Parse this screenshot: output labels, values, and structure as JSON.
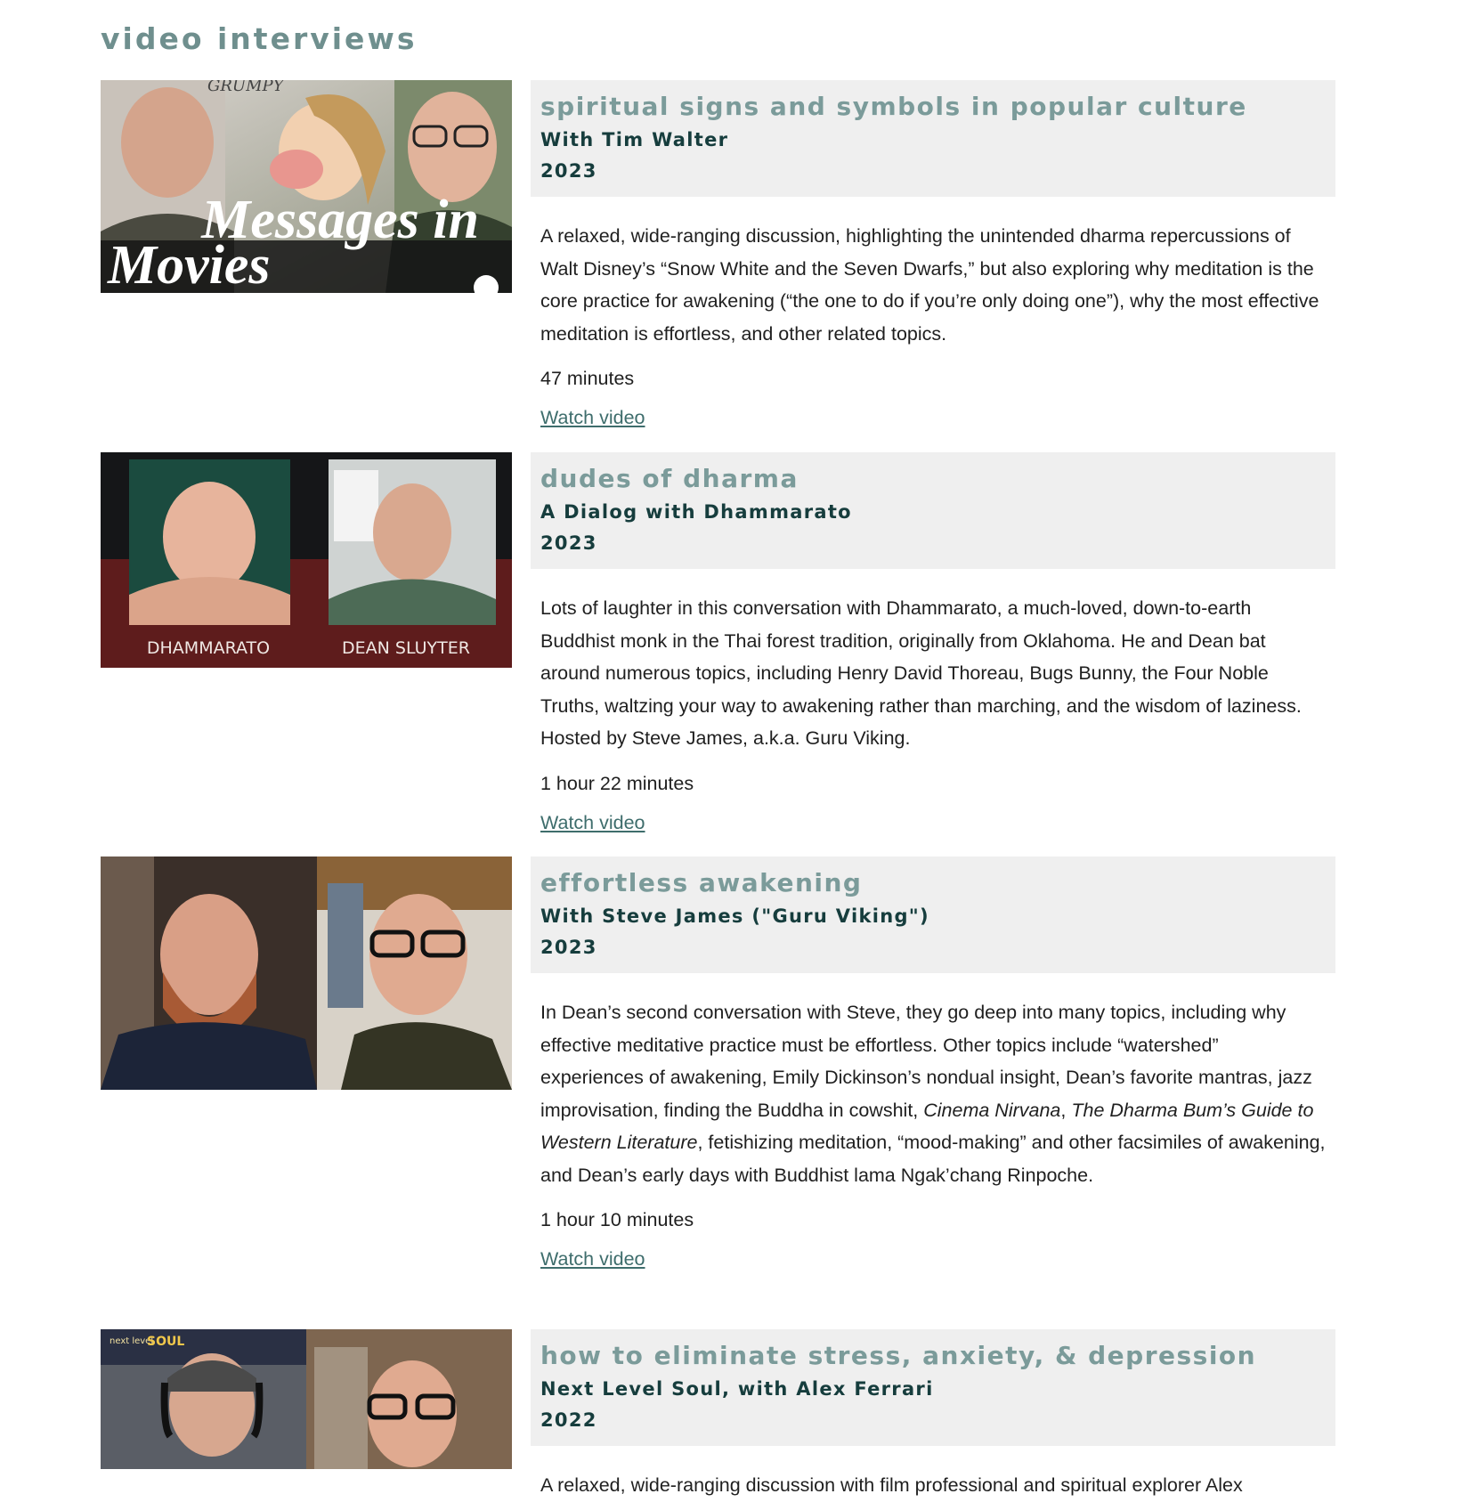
{
  "page": {
    "section_title": "video interviews"
  },
  "entries": [
    {
      "title": "spiritual signs and symbols in popular culture",
      "subtitle": "With Tim Walter",
      "year": "2023",
      "description": "A relaxed, wide-ranging discussion, highlighting the unintended dharma repercussions of Walt Disney’s “Snow White and the Seven Dwarfs,” but also exploring why meditation is the core practice for awakening (“the one to do if you’re only doing one”), why the most effective meditation is effortless, and other related topics.",
      "duration": "47 minutes",
      "link_label": "Watch video",
      "thumb_text_1": "Messages in",
      "thumb_text_2": "Movies",
      "thumb_scribble": "GRUMPY"
    },
    {
      "title": "dudes of dharma",
      "subtitle": "A Dialog with Dhammarato",
      "year": "2023",
      "description": "Lots of laughter in this conversation with Dhammarato, a much-loved, down-to-earth Buddhist monk in the Thai forest tradition, originally from Oklahoma. He and Dean bat around numerous topics, including Henry David Thoreau, Bugs Bunny, the Four Noble Truths, waltzing your way to awakening rather than marching, and the wisdom of laziness. Hosted by Steve James, a.k.a. Guru Viking.",
      "duration": "1 hour 22 minutes",
      "link_label": "Watch video",
      "thumb_label_left": "DHAMMARATO",
      "thumb_label_right": "DEAN SLUYTER"
    },
    {
      "title": "effortless awakening",
      "subtitle": "With Steve James (\"Guru Viking\")",
      "year": "2023",
      "description_parts": {
        "p1": "In Dean’s second conversation with Steve, they go deep into many topics, including why effective meditative practice must be effortless. Other topics include “watershed” experiences of awakening, Emily Dickinson’s nondual insight, Dean’s favorite mantras, jazz improvisation, finding the Buddha in cowshit, ",
        "i1": "Cinema Nirvana",
        "p2": ", ",
        "i2": "The Dharma Bum’s Guide to Western Literature",
        "p3": ", fetishizing meditation, “mood-making” and other facsimiles of awakening, and Dean’s early days with Buddhist lama Ngak’chang Rinpoche."
      },
      "duration": "1 hour 10 minutes",
      "link_label": "Watch video"
    },
    {
      "title": "how to eliminate stress, anxiety, & depression",
      "subtitle": "Next Level Soul, with Alex Ferrari",
      "year": "2022",
      "description": "A relaxed, wide-ranging discussion with film professional and spiritual explorer Alex",
      "thumb_badge_small": "next level",
      "thumb_badge_big": "SOUL"
    }
  ],
  "colors": {
    "section_title": "#6f8f8e",
    "entry_title": "#7b9b9a",
    "entry_meta": "#163d3d",
    "header_bg": "#efefef",
    "link": "#3e6d6c"
  }
}
